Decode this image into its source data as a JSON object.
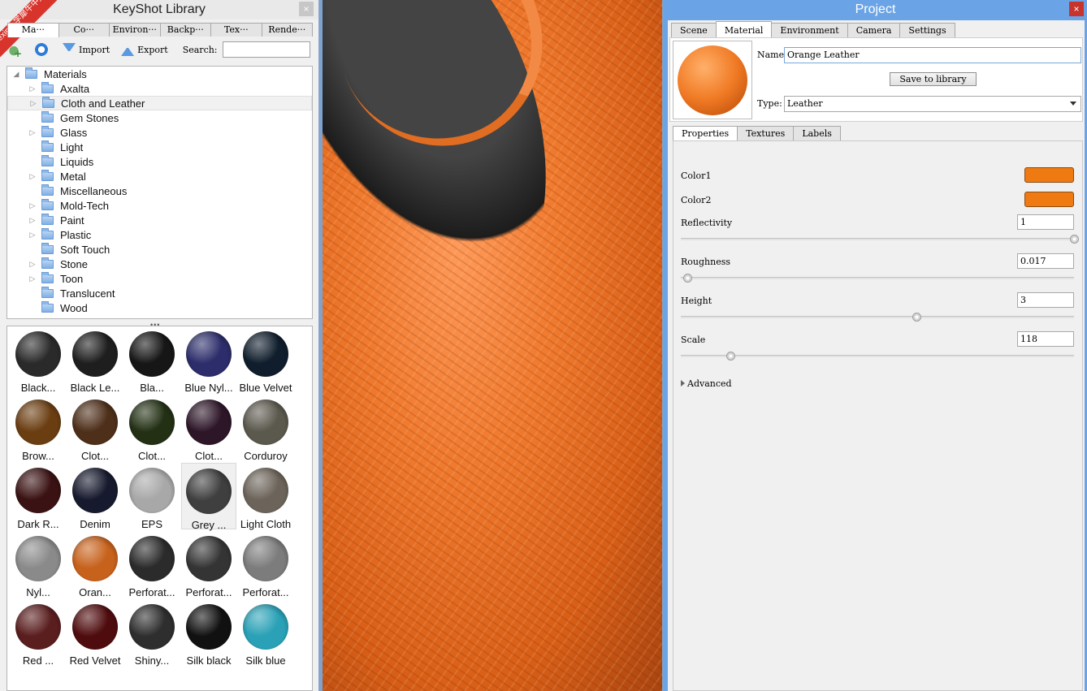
{
  "library": {
    "title": "KeyShot Library",
    "close": "×",
    "badge": "xuexiniu 学犀牛中文网",
    "tabs": [
      "Ma···",
      "Co···",
      "Environ···",
      "Backp···",
      "Tex···",
      "Rende···"
    ],
    "toolbar": {
      "import": "Import",
      "export": "Export",
      "search_label": "Search:",
      "search_value": ""
    },
    "tree": {
      "root": "Materials",
      "items": [
        {
          "label": "Axalta",
          "expandable": true
        },
        {
          "label": "Cloth and Leather",
          "expandable": true,
          "selected": true
        },
        {
          "label": "Gem Stones",
          "expandable": false
        },
        {
          "label": "Glass",
          "expandable": true
        },
        {
          "label": "Light",
          "expandable": false
        },
        {
          "label": "Liquids",
          "expandable": false
        },
        {
          "label": "Metal",
          "expandable": true
        },
        {
          "label": "Miscellaneous",
          "expandable": false
        },
        {
          "label": "Mold-Tech",
          "expandable": true
        },
        {
          "label": "Paint",
          "expandable": true
        },
        {
          "label": "Plastic",
          "expandable": true
        },
        {
          "label": "Soft Touch",
          "expandable": false
        },
        {
          "label": "Stone",
          "expandable": true
        },
        {
          "label": "Toon",
          "expandable": true
        },
        {
          "label": "Translucent",
          "expandable": false
        },
        {
          "label": "Wood",
          "expandable": false
        }
      ]
    },
    "materials": [
      {
        "label": "Black...",
        "color": "#2a2a2a"
      },
      {
        "label": "Black Le...",
        "color": "#1e1e1e"
      },
      {
        "label": "Bla...",
        "color": "#161616"
      },
      {
        "label": "Blue Nyl...",
        "color": "#2c2d6a"
      },
      {
        "label": "Blue Velvet",
        "color": "#0f1d2c"
      },
      {
        "label": "Brow...",
        "color": "#6b3e12"
      },
      {
        "label": "Clot...",
        "color": "#4e2f1a"
      },
      {
        "label": "Clot...",
        "color": "#233014"
      },
      {
        "label": "Clot...",
        "color": "#2d1628"
      },
      {
        "label": "Corduroy",
        "color": "#5b584d"
      },
      {
        "label": "Dark R...",
        "color": "#3a1213"
      },
      {
        "label": "Denim",
        "color": "#171a2e"
      },
      {
        "label": "EPS",
        "color": "#a8a8a8"
      },
      {
        "label": "Grey ...",
        "color": "#3f3f3f",
        "selected": true
      },
      {
        "label": "Light Cloth",
        "color": "#6c645a"
      },
      {
        "label": "Nyl...",
        "color": "#8a8a8a"
      },
      {
        "label": "Oran...",
        "color": "#c7621d"
      },
      {
        "label": "Perforat...",
        "color": "#2b2b2b"
      },
      {
        "label": "Perforat...",
        "color": "#343434"
      },
      {
        "label": "Perforat...",
        "color": "#7c7c7c"
      },
      {
        "label": "Red ...",
        "color": "#5a1e1f"
      },
      {
        "label": "Red Velvet",
        "color": "#4f0c0e"
      },
      {
        "label": "Shiny...",
        "color": "#2e2e2e"
      },
      {
        "label": "Silk black",
        "color": "#111111"
      },
      {
        "label": "Silk blue",
        "color": "#2aa1b6"
      }
    ]
  },
  "project": {
    "title": "Project",
    "close": "×",
    "tabs": [
      "Scene",
      "Material",
      "Environment",
      "Camera",
      "Settings"
    ],
    "active_tab": "Material",
    "name_label": "Name:",
    "name_value": "Orange Leather",
    "save_label": "Save to library",
    "type_label": "Type:",
    "type_value": "Leather",
    "sub_tabs": [
      "Properties",
      "Textures",
      "Labels"
    ],
    "active_sub_tab": "Properties",
    "props": {
      "color1_label": "Color1",
      "color1": "#f07a12",
      "color2_label": "Color2",
      "color2": "#f07a12",
      "reflectivity_label": "Reflectivity",
      "reflectivity": "1",
      "reflectivity_level": 1.0,
      "roughness_label": "Roughness",
      "roughness": "0.017",
      "roughness_level": 0.017,
      "height_label": "Height",
      "height": "3",
      "height_level": 0.6,
      "scale_label": "Scale",
      "scale": "118",
      "scale_level": 0.125,
      "advanced_label": "Advanced"
    }
  }
}
